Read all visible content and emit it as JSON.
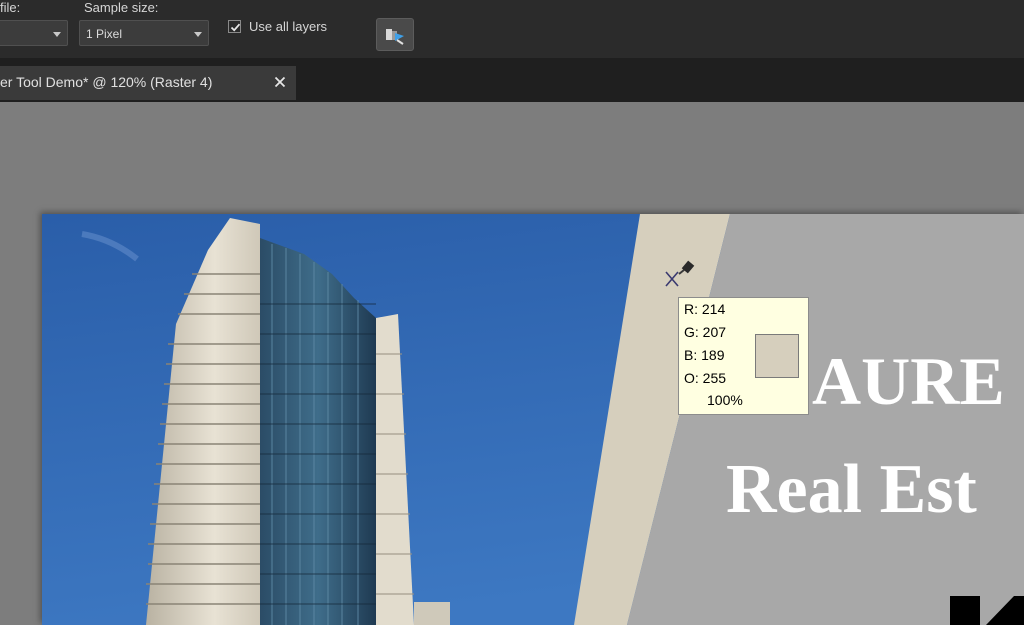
{
  "toolbar": {
    "profile_label": "file:",
    "sample_size_label": "Sample size:",
    "sample_size_value": "1 Pixel",
    "use_all_layers_label": "Use all layers",
    "use_all_layers_checked": true,
    "action_icon": "apply-to-layer-icon"
  },
  "tab": {
    "title": "er Tool Demo* @ 120% (Raster 4)",
    "close_icon": "close-icon"
  },
  "canvas": {
    "heading_line1": "AURE",
    "heading_line2": "Real Est",
    "colors": {
      "sky": "#2f62ad",
      "stripe": "#d6cfbd",
      "panel": "#a8a8a8"
    }
  },
  "tooltip": {
    "r": "R: 214",
    "g": "G: 207",
    "b": "B: 189",
    "o": "O: 255",
    "opacity": "100%",
    "swatch_color": "#d6cfbd"
  },
  "cursor": {
    "icon": "dropper-crosshair-icon"
  }
}
